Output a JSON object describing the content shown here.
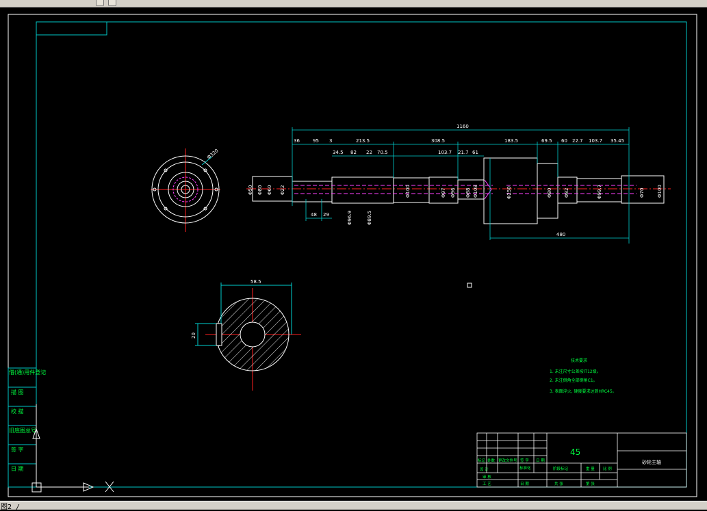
{
  "window": {
    "status_text": "图2 /"
  },
  "drawing": {
    "overall_length": "1160",
    "top_dims": [
      "36",
      "95",
      "3",
      "213.5",
      "308.5",
      "183.5",
      "69.5",
      "60",
      "22.7",
      "103.7",
      "35.45"
    ],
    "second_dims": [
      "34.5",
      "82",
      "22",
      "70.5",
      "103.7",
      "21.7",
      "61"
    ],
    "diameters_left": [
      "Φ50",
      "Φ80",
      "Φ60",
      "Φ22"
    ],
    "diameters_mid": [
      "Φ100",
      "Φ97",
      "Φ96",
      "Φ88",
      "Φ108",
      "Φ250",
      "Φ80",
      "Φ82",
      "Φ99.7",
      "Φ70",
      "Φ100"
    ],
    "lower_dims": [
      "48",
      "29"
    ],
    "lower_diams": [
      "Φ96.9",
      "Φ89.5"
    ],
    "bottom_dim": "480",
    "end_view_dim": "Φ320",
    "section_width": "58.5",
    "section_depth": "20",
    "tech_title": "技术要求",
    "tech_notes": [
      "1. 未注尺寸公差按IT12级。",
      "2. 未注倒角全部倒角C1。",
      "3. 表面淬火, 硬度要求达到HRC45。"
    ]
  },
  "left_strip": [
    "借(通)用件登记",
    "描   图",
    "校   描",
    "旧底图总号",
    "签   字",
    "日   期"
  ],
  "title_block": {
    "material": "45",
    "part_name": "砂轮主轴",
    "row_labels": [
      "标记",
      "处数",
      "更改文件号",
      "签 字",
      "日 期"
    ],
    "col_labels": [
      "设 计",
      "标准化"
    ],
    "stage_labels": [
      "阶段标记",
      "重 量",
      "比 例"
    ],
    "bottom_labels": [
      "审 核",
      "工 艺",
      "日 期",
      "共   张",
      "第   张"
    ]
  },
  "colors": {
    "frame": "#00c8c8",
    "line": "#ffffff",
    "dim": "#00d0d0",
    "center": "#ff2020",
    "hidden": "#ff40ff",
    "text_green": "#00ff40",
    "hatch": "#ffffff"
  }
}
